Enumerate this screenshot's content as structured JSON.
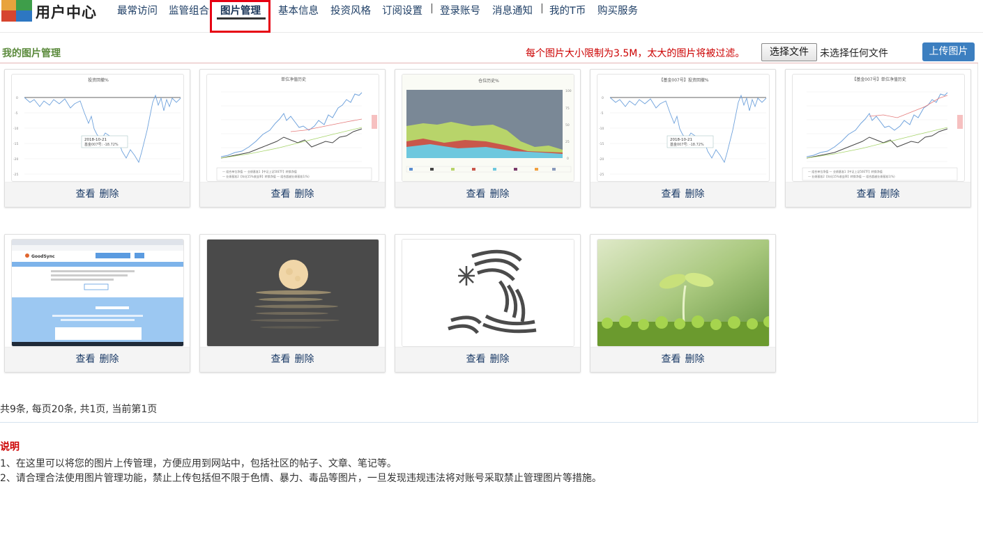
{
  "header": {
    "brand": "用户中心",
    "nav": [
      {
        "label": "最常访问"
      },
      {
        "label": "监管组合"
      },
      {
        "label": "图片管理",
        "active": true
      },
      {
        "label": "基本信息"
      },
      {
        "label": "投资风格"
      },
      {
        "label": "订阅设置"
      },
      {
        "label": "登录账号"
      },
      {
        "label": "消息通知"
      },
      {
        "label": "我的T币"
      },
      {
        "label": "购买服务"
      }
    ],
    "separator": "|"
  },
  "section": {
    "title": "我的图片管理",
    "limit_notice": "每个图片大小限制为3.5M，太大的图片将被过滤。",
    "file_button": "选择文件",
    "file_status": "未选择任何文件",
    "upload_button": "上传图片"
  },
  "cards": [
    {
      "kind": "chart",
      "caption": "投资回撤%",
      "view": "查看",
      "delete": "删除"
    },
    {
      "kind": "chart",
      "caption": "单位净值历史",
      "view": "查看",
      "delete": "删除"
    },
    {
      "kind": "chart",
      "caption": "仓位历史%",
      "view": "查看",
      "delete": "删除"
    },
    {
      "kind": "chart",
      "caption": "【基金007号】投资回撤%",
      "view": "查看",
      "delete": "删除"
    },
    {
      "kind": "chart",
      "caption": "【基金007号】单位净值历史",
      "view": "查看",
      "delete": "删除"
    },
    {
      "kind": "screenshot",
      "caption": "GoodSync",
      "view": "查看",
      "delete": "删除"
    },
    {
      "kind": "photo",
      "caption": "",
      "view": "查看",
      "delete": "删除"
    },
    {
      "kind": "logo",
      "caption": "",
      "view": "查看",
      "delete": "删除"
    },
    {
      "kind": "photo",
      "caption": "",
      "view": "查看",
      "delete": "删除"
    }
  ],
  "pagination": {
    "text": "共9条, 每页20条, 共1页, 当前第1页"
  },
  "notes": {
    "title": "说明",
    "items": [
      "1、在这里可以将您的图片上传管理，方便应用到网站中，包括社区的帖子、文章、笔记等。",
      "2、请合理合法使用图片管理功能，禁止上传包括但不限于色情、暴力、毒品等图片，一旦发现违规违法将对账号采取禁止管理图片等措施。"
    ]
  },
  "colors": {
    "nav_text": "#1f3f66",
    "section_title": "#5b8a3c",
    "warning": "#cc0000",
    "upload_button": "#3c7fc0",
    "highlight": "#e60012"
  }
}
